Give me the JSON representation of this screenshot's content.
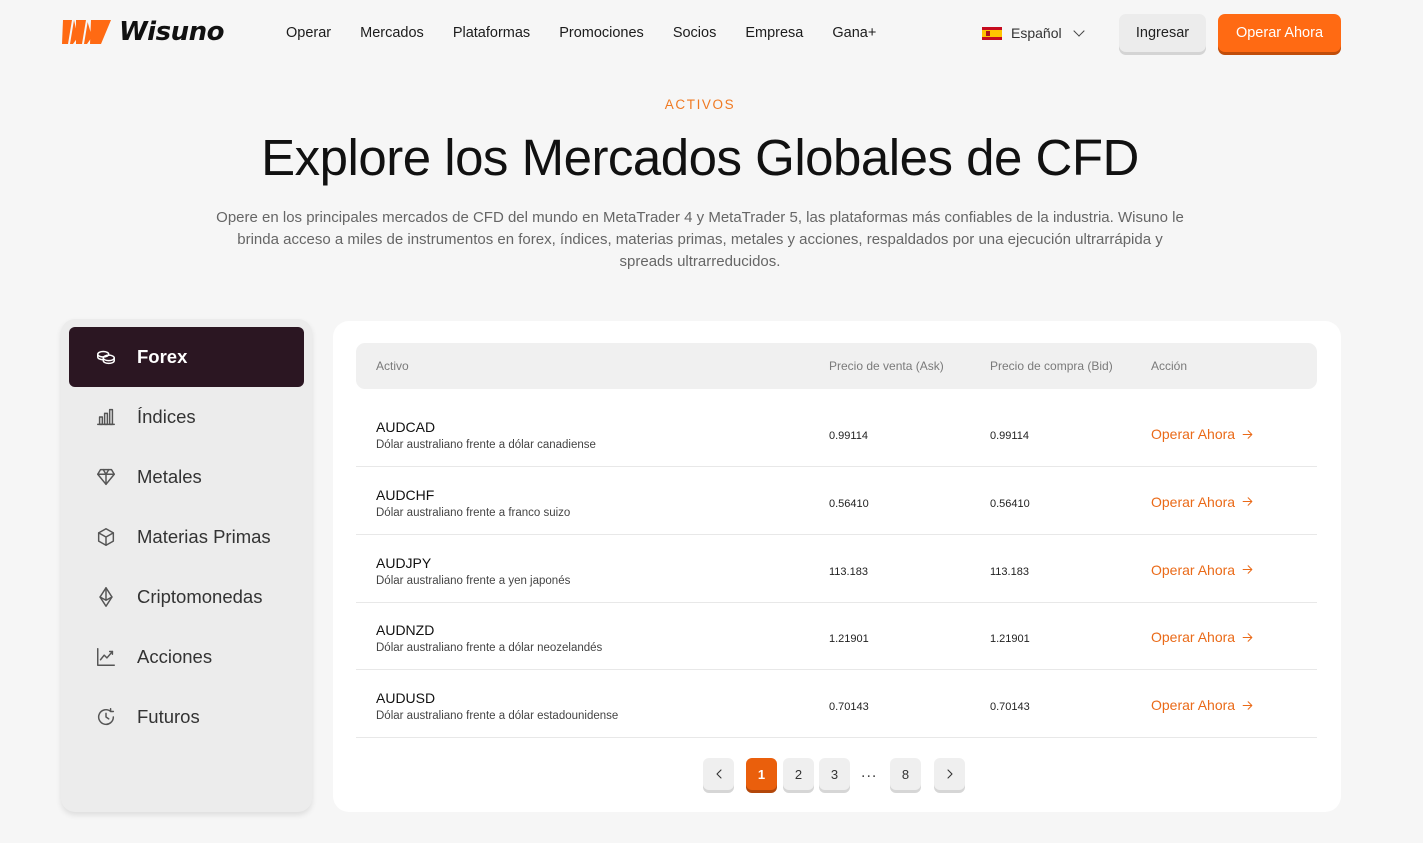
{
  "brand": {
    "name": "Wisuno",
    "accent_color": "#ff6a13",
    "dark_color": "#2b1622"
  },
  "nav": {
    "items": [
      "Operar",
      "Mercados",
      "Plataformas",
      "Promociones",
      "Socios",
      "Empresa",
      "Gana+"
    ]
  },
  "language": {
    "label": "Español",
    "flag_icon": "spain-flag-icon"
  },
  "header_buttons": {
    "login": "Ingresar",
    "trade": "Operar Ahora"
  },
  "hero": {
    "eyebrow": "ACTIVOS",
    "title": "Explore los Mercados Globales de CFD",
    "subtitle": "Opere en los principales mercados de CFD del mundo en MetaTrader 4 y MetaTrader 5, las plataformas más confiables de la industria. Wisuno le brinda acceso a miles de instrumentos en forex, índices, materias primas, metales y acciones, respaldados por una ejecución ultrarrápida y spreads ultrarreducidos."
  },
  "sidebar": {
    "active_index": 0,
    "items": [
      {
        "label": "Forex",
        "icon": "coins-icon"
      },
      {
        "label": "Índices",
        "icon": "bar-chart-icon"
      },
      {
        "label": "Metales",
        "icon": "diamond-icon"
      },
      {
        "label": "Materias Primas",
        "icon": "box-icon"
      },
      {
        "label": "Criptomonedas",
        "icon": "ethereum-icon"
      },
      {
        "label": "Acciones",
        "icon": "trend-chart-icon"
      },
      {
        "label": "Futuros",
        "icon": "clock-icon"
      }
    ]
  },
  "table": {
    "headers": {
      "asset": "Activo",
      "ask": "Precio de venta (Ask)",
      "bid": "Precio de compra (Bid)",
      "action": "Acción"
    },
    "rows": [
      {
        "symbol": "AUDCAD",
        "description": "Dólar australiano frente a dólar canadiense",
        "ask": "0.99114",
        "bid": "0.99114",
        "action": "Operar Ahora"
      },
      {
        "symbol": "AUDCHF",
        "description": "Dólar australiano frente a franco suizo",
        "ask": "0.56410",
        "bid": "0.56410",
        "action": "Operar Ahora"
      },
      {
        "symbol": "AUDJPY",
        "description": "Dólar australiano frente a yen japonés",
        "ask": "113.183",
        "bid": "113.183",
        "action": "Operar Ahora"
      },
      {
        "symbol": "AUDNZD",
        "description": "Dólar australiano frente a dólar neozelandés",
        "ask": "1.21901",
        "bid": "1.21901",
        "action": "Operar Ahora"
      },
      {
        "symbol": "AUDUSD",
        "description": "Dólar australiano frente a dólar estadounidense",
        "ask": "0.70143",
        "bid": "0.70143",
        "action": "Operar Ahora"
      }
    ]
  },
  "pagination": {
    "prev_icon": "chevron-left-icon",
    "next_icon": "chevron-right-icon",
    "pages": [
      "1",
      "2",
      "3"
    ],
    "ellipsis": "...",
    "last_page": "8",
    "current": "1"
  }
}
